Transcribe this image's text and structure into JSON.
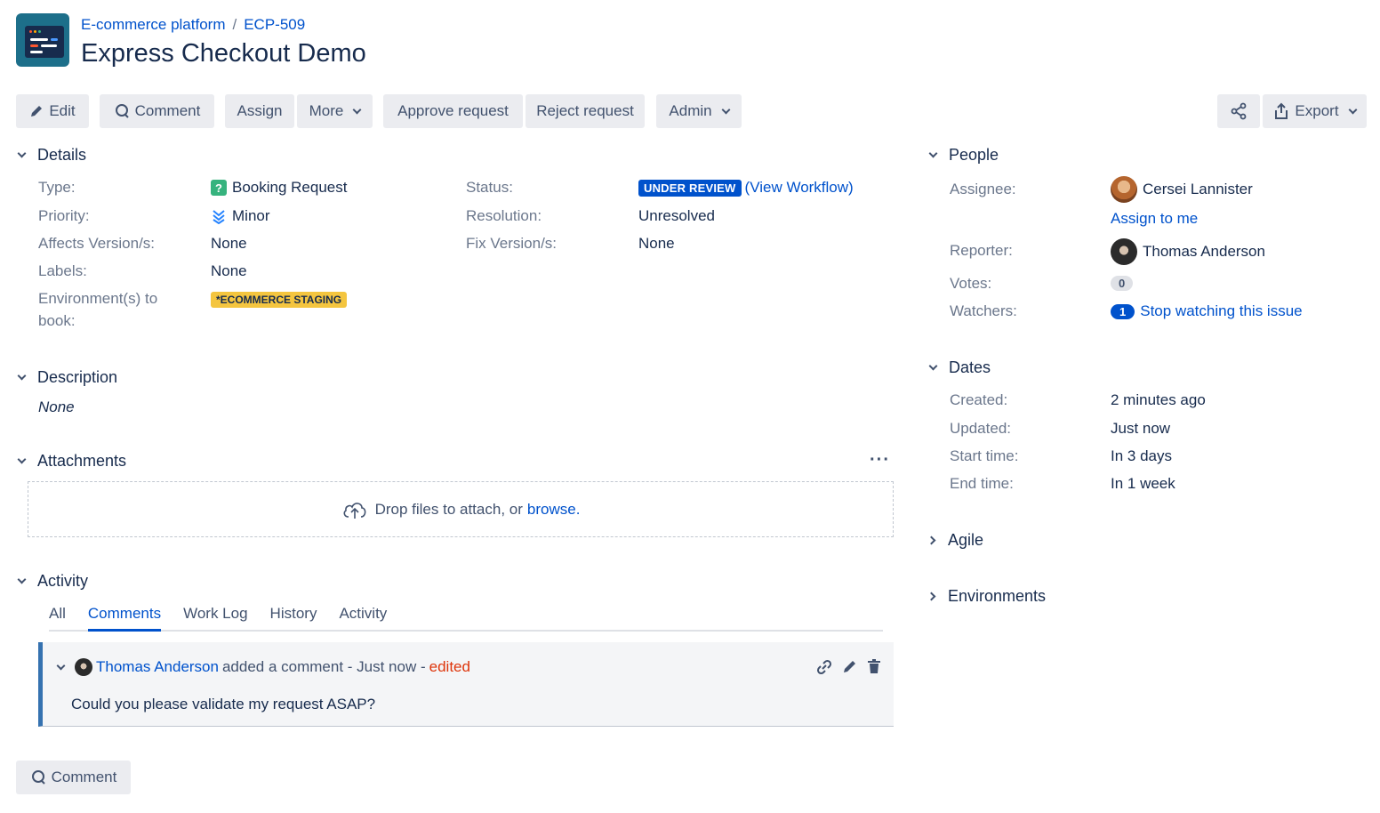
{
  "breadcrumb": {
    "project": "E-commerce platform",
    "issue_key": "ECP-509"
  },
  "issue": {
    "title": "Express Checkout Demo"
  },
  "toolbar": {
    "edit": "Edit",
    "comment": "Comment",
    "assign": "Assign",
    "more": "More",
    "approve": "Approve request",
    "reject": "Reject request",
    "admin": "Admin",
    "export": "Export"
  },
  "details": {
    "header": "Details",
    "type_label": "Type:",
    "type_value": "Booking Request",
    "priority_label": "Priority:",
    "priority_value": "Minor",
    "affects_label": "Affects Version/s:",
    "affects_value": "None",
    "labels_label": "Labels:",
    "labels_value": "None",
    "env_label_1": "Environment(s) to",
    "env_label_2": "book:",
    "env_value": "*ECOMMERCE STAGING",
    "status_label": "Status:",
    "status_value": "UNDER REVIEW",
    "workflow_link": "(View Workflow)",
    "resolution_label": "Resolution:",
    "resolution_value": "Unresolved",
    "fix_label": "Fix Version/s:",
    "fix_value": "None"
  },
  "description": {
    "header": "Description",
    "value": "None"
  },
  "attachments": {
    "header": "Attachments",
    "drop_text": "Drop files to attach, or",
    "browse": "browse."
  },
  "activity": {
    "header": "Activity",
    "tabs": [
      "All",
      "Comments",
      "Work Log",
      "History",
      "Activity"
    ],
    "active_tab": "Comments",
    "comment": {
      "author": "Thomas Anderson",
      "action": "added a comment - Just now -",
      "edited": "edited",
      "body": "Could you please validate my request ASAP?"
    },
    "comment_button": "Comment"
  },
  "people": {
    "header": "People",
    "assignee_label": "Assignee:",
    "assignee": "Cersei Lannister",
    "assign_to_me": "Assign to me",
    "reporter_label": "Reporter:",
    "reporter": "Thomas Anderson",
    "votes_label": "Votes:",
    "votes": "0",
    "watchers_label": "Watchers:",
    "watchers_count": "1",
    "watch_link": "Stop watching this issue"
  },
  "dates": {
    "header": "Dates",
    "created_label": "Created:",
    "created": "2 minutes ago",
    "updated_label": "Updated:",
    "updated": "Just now",
    "start_label": "Start time:",
    "start": "In 3 days",
    "end_label": "End time:",
    "end": "In 1 week"
  },
  "agile": {
    "header": "Agile"
  },
  "environments": {
    "header": "Environments"
  },
  "colors": {
    "link": "#0052cc",
    "status": "#0052cc",
    "env": "#f4c53f",
    "edited": "#de350b"
  }
}
